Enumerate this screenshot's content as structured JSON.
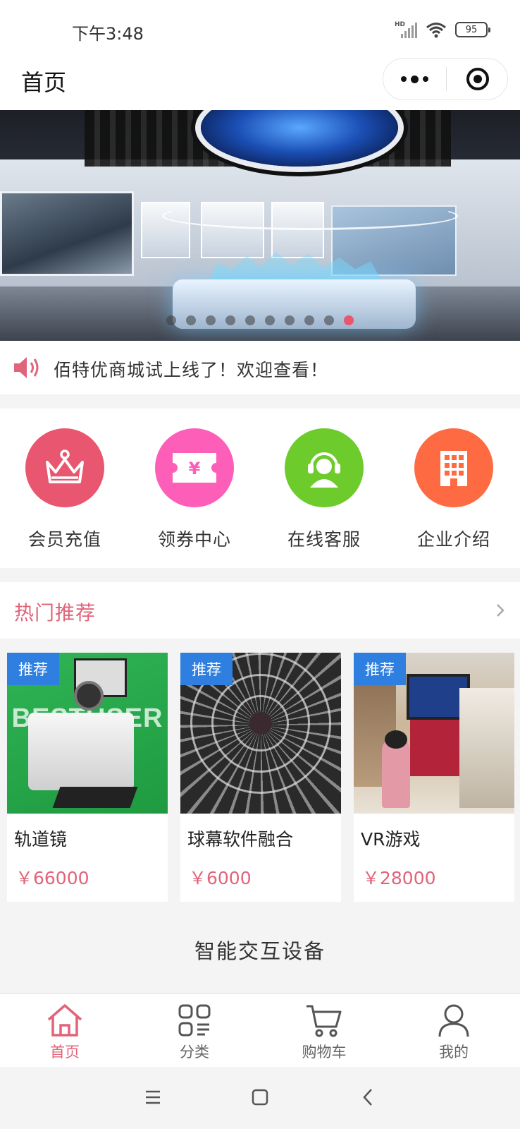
{
  "status_bar": {
    "time": "下午3:48",
    "signal_label": "HD",
    "battery": "95"
  },
  "nav": {
    "title": "首页"
  },
  "banner": {
    "slide_count": 10,
    "active_index": 9
  },
  "notice": {
    "text": "佰特优商城试上线了！欢迎查看！"
  },
  "quick_links": [
    {
      "label": "会员充值",
      "icon": "crown-icon",
      "color": "#e8566f"
    },
    {
      "label": "领券中心",
      "icon": "coupon-icon",
      "color": "#fd5fb8"
    },
    {
      "label": "在线客服",
      "icon": "customer-service-icon",
      "color": "#6dcb2b"
    },
    {
      "label": "企业介绍",
      "icon": "building-icon",
      "color": "#fe6a42"
    }
  ],
  "hot": {
    "title": "热门推荐"
  },
  "products": [
    {
      "tag": "推荐",
      "name": "轨道镜",
      "price": "￥66000"
    },
    {
      "tag": "推荐",
      "name": "球幕软件融合",
      "price": "￥6000"
    },
    {
      "tag": "推荐",
      "name": "VR游戏",
      "price": "￥28000"
    }
  ],
  "product_images": {
    "brand_text": "BESTUSER"
  },
  "category": {
    "title": "智能交互设备"
  },
  "tabbar": [
    {
      "label": "首页",
      "icon": "home-icon",
      "active": true
    },
    {
      "label": "分类",
      "icon": "category-icon",
      "active": false
    },
    {
      "label": "购物车",
      "icon": "cart-icon",
      "active": false
    },
    {
      "label": "我的",
      "icon": "user-icon",
      "active": false
    }
  ],
  "colors": {
    "accent": "#e0647a",
    "tag_blue": "#2f7fe0",
    "background": "#f4f4f4"
  }
}
